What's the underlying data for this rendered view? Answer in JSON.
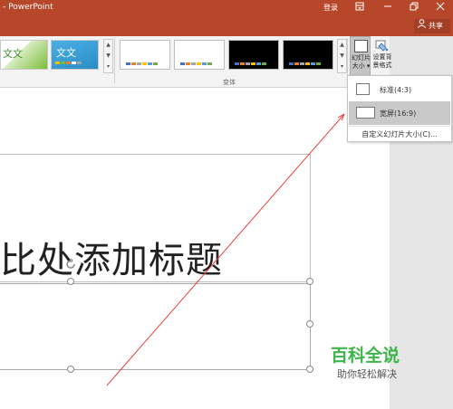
{
  "titlebar": {
    "title": "- PowerPoint",
    "login": "登录",
    "ribbon_display_icon": "ribbon-display-icon",
    "minimize_icon": "minimize-icon",
    "restore_icon": "restore-icon",
    "close_icon": "close-icon",
    "share": "共享",
    "share_icon": "person-icon",
    "color": "#b7472a"
  },
  "ribbon": {
    "themes": [
      {
        "label": "文文",
        "colors": [
          "#7dbb3a",
          "#e6e6e6"
        ]
      },
      {
        "label": "文文",
        "colors": [
          "#3aa0d8",
          "#e6e6e6"
        ]
      }
    ],
    "variants": [
      {
        "background": "#ffffff",
        "bars": [
          "#4472c4",
          "#ed7d31",
          "#a5a5a5",
          "#ffc000",
          "#5b9bd5",
          "#70ad47"
        ]
      },
      {
        "background": "#ffffff",
        "bars": [
          "#4472c4",
          "#ed7d31",
          "#a5a5a5",
          "#ffc000",
          "#5b9bd5",
          "#70ad47"
        ]
      },
      {
        "background": "#000000",
        "bars": [
          "#4472c4",
          "#ed7d31",
          "#a5a5a5",
          "#ffc000",
          "#5b9bd5",
          "#70ad47"
        ]
      },
      {
        "background": "#000000",
        "bars": [
          "#4472c4",
          "#ed7d31",
          "#a5a5a5",
          "#ffc000",
          "#5b9bd5",
          "#70ad47"
        ]
      }
    ],
    "variants_group_label": "变体",
    "slide_size_label": "幻灯片大小",
    "slide_size_line1": "幻灯片",
    "slide_size_line2": "大小 ▾",
    "format_bg_line1": "设置背",
    "format_bg_line2": "景格式"
  },
  "dropdown": {
    "items": [
      {
        "label": "标准(4:3)",
        "selected": false
      },
      {
        "label": "宽屏(16:9)",
        "selected": true
      }
    ],
    "custom": "自定义幻灯片大小(C)..."
  },
  "slide": {
    "title_text": "比处添加标题"
  },
  "watermark": {
    "main": "百科全说",
    "sub": "助你轻松解决",
    "color": "#3cb54a"
  }
}
